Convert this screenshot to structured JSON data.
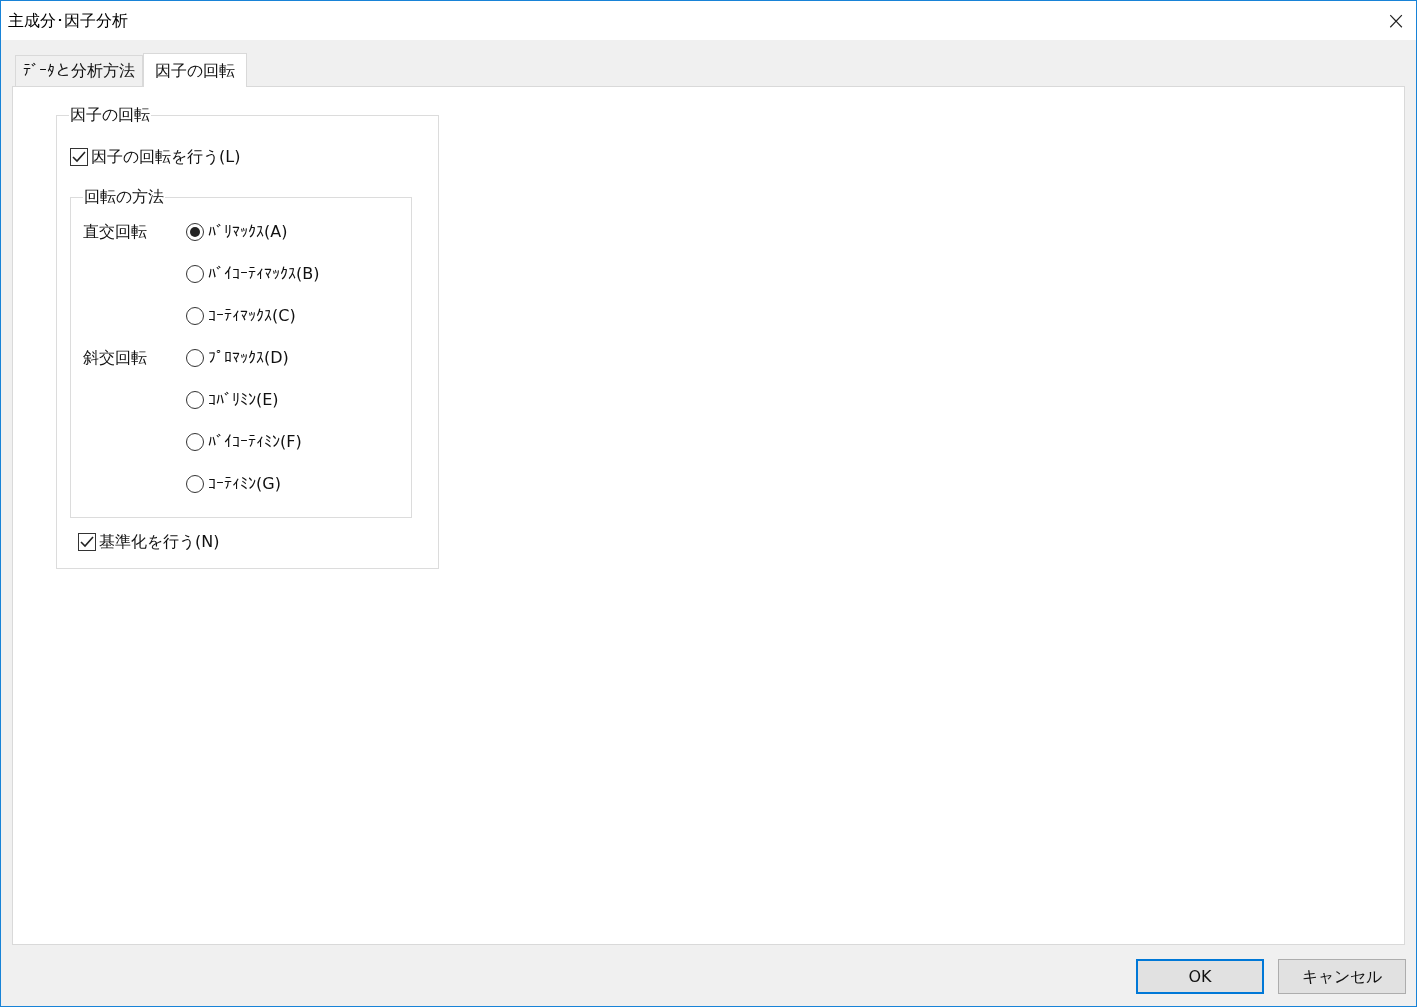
{
  "window": {
    "title": "主成分･因子分析",
    "close": "×"
  },
  "tabs": [
    {
      "label": "ﾃﾞｰﾀと分析方法",
      "selected": false
    },
    {
      "label": "因子の回転",
      "selected": true
    }
  ],
  "rotation_group": {
    "title": "因子の回転",
    "do_rotation": {
      "label": "因子の回転を行う(L)",
      "checked": true
    },
    "method_group": {
      "title": "回転の方法",
      "groups": [
        {
          "label": "直交回転",
          "options": [
            {
              "label": "ﾊﾞﾘﾏｯｸｽ(A)",
              "selected": true
            },
            {
              "label": "ﾊﾞｲｺｰﾃｨﾏｯｸｽ(B)",
              "selected": false
            },
            {
              "label": "ｺｰﾃｨﾏｯｸｽ(C)",
              "selected": false
            }
          ]
        },
        {
          "label": "斜交回転",
          "options": [
            {
              "label": "ﾌﾟﾛﾏｯｸｽ(D)",
              "selected": false
            },
            {
              "label": "ｺﾊﾞﾘﾐﾝ(E)",
              "selected": false
            },
            {
              "label": "ﾊﾞｲｺｰﾃｨﾐﾝ(F)",
              "selected": false
            },
            {
              "label": "ｺｰﾃｨﾐﾝ(G)",
              "selected": false
            }
          ]
        }
      ]
    },
    "standardize": {
      "label": "基準化を行う(N)",
      "checked": true
    }
  },
  "buttons": [
    {
      "label": "OK",
      "default": true
    },
    {
      "label": "キャンセル",
      "default": false
    }
  ]
}
